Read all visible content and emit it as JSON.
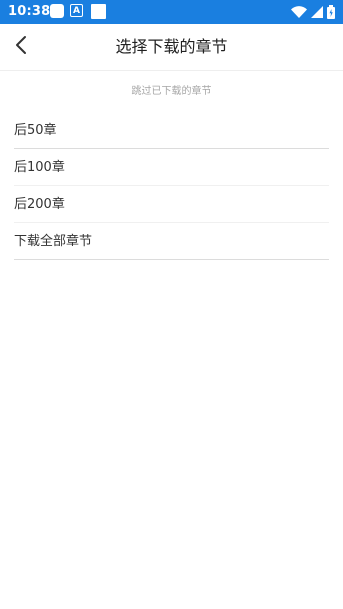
{
  "status_bar": {
    "time": "10:38",
    "notification_icons": [
      "square-app-icon",
      "a-box-icon",
      "square-white-icon"
    ],
    "right_icons": [
      "wifi-icon",
      "signal-icon",
      "battery-charging-icon"
    ],
    "background_color": "#1a7fe0"
  },
  "header": {
    "title": "选择下载的章节",
    "back_icon": "chevron-left-icon"
  },
  "main": {
    "hint": "跳过已下载的章节",
    "options": [
      {
        "label": "后50章"
      },
      {
        "label": "后100章"
      },
      {
        "label": "后200章"
      },
      {
        "label": "下载全部章节"
      }
    ]
  },
  "misc": {
    "a_icon_letter": "A"
  }
}
